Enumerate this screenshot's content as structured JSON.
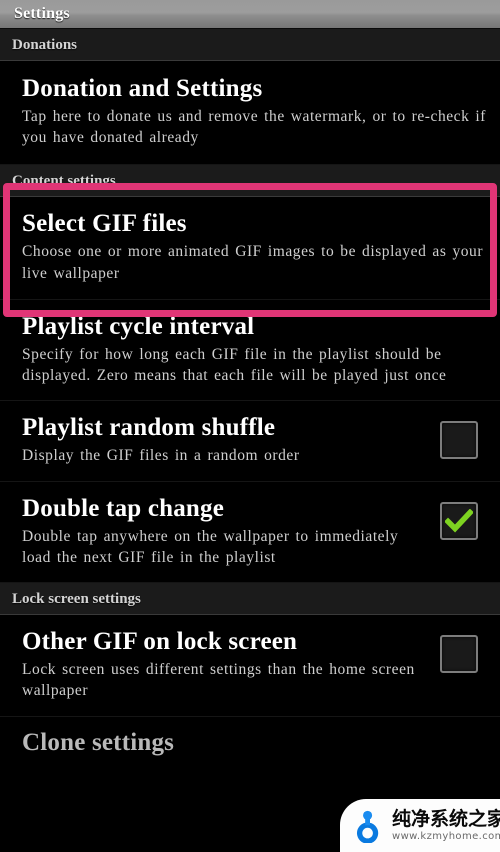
{
  "window": {
    "title": "Settings"
  },
  "colors": {
    "highlight_border": "#e03576",
    "checkmark_green": "#7ed321",
    "title_bar_gray": "#9a9a9a",
    "section_header_bg": "#1b1b1b",
    "page_bg": "#000000",
    "logo_blue": "#1a8cf0"
  },
  "sections": [
    {
      "header": "Donations",
      "rows": [
        {
          "title": "Donation and Settings",
          "summary": "Tap here to donate us and remove the watermark, or to re-check if you have donated already",
          "checkbox": null
        }
      ]
    },
    {
      "header": "Content settings",
      "rows": [
        {
          "title": "Select GIF files",
          "summary": "Choose one or more animated GIF images to be displayed as your live wallpaper",
          "checkbox": null
        },
        {
          "title": "Playlist cycle interval",
          "summary": "Specify for how long each GIF file in the playlist should be displayed. Zero means that each file will be played just once",
          "checkbox": null
        },
        {
          "title": "Playlist random shuffle",
          "summary": "Display the GIF files in a random order",
          "checkbox": "unchecked"
        },
        {
          "title": "Double tap change",
          "summary": "Double tap anywhere on the wallpaper to immediately load the next GIF file in the playlist",
          "checkbox": "checked"
        }
      ]
    },
    {
      "header": "Lock screen settings",
      "rows": [
        {
          "title": "Other GIF on lock screen",
          "summary": "Lock screen uses different settings than the home screen wallpaper",
          "checkbox": "unchecked"
        },
        {
          "title": "Clone settings",
          "summary": "",
          "checkbox": null
        }
      ]
    }
  ],
  "highlight": {
    "target_row_title": "Select GIF files"
  },
  "watermark": {
    "brand_cn": "纯净系统之家",
    "url": "www.kzmyhome.com"
  }
}
